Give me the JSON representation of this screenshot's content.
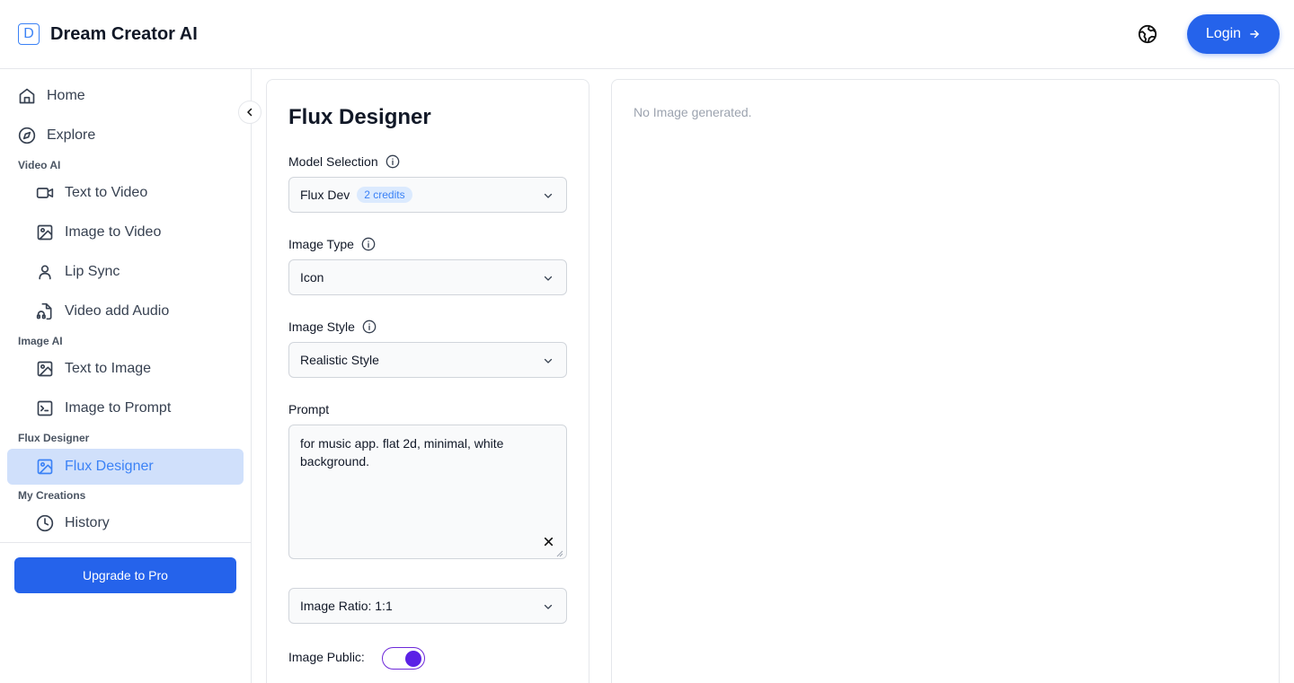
{
  "header": {
    "logo_letter": "D",
    "app_title": "Dream Creator AI",
    "login_label": "Login"
  },
  "sidebar": {
    "top_items": [
      {
        "label": "Home",
        "icon": "home-icon"
      },
      {
        "label": "Explore",
        "icon": "compass-icon"
      }
    ],
    "sections": [
      {
        "label": "Video AI",
        "items": [
          {
            "label": "Text to Video",
            "icon": "video-camera-icon"
          },
          {
            "label": "Image to Video",
            "icon": "image-icon"
          },
          {
            "label": "Lip Sync",
            "icon": "user-icon"
          },
          {
            "label": "Video add Audio",
            "icon": "file-audio-icon"
          }
        ]
      },
      {
        "label": "Image AI",
        "items": [
          {
            "label": "Text to Image",
            "icon": "image-icon"
          },
          {
            "label": "Image to Prompt",
            "icon": "terminal-icon"
          }
        ]
      },
      {
        "label": "Flux Designer",
        "items": [
          {
            "label": "Flux Designer",
            "icon": "image-icon",
            "active": true
          }
        ]
      },
      {
        "label": "My Creations",
        "items": [
          {
            "label": "History",
            "icon": "clock-icon"
          }
        ]
      }
    ],
    "upgrade_label": "Upgrade to Pro"
  },
  "form": {
    "title": "Flux Designer",
    "model_label": "Model Selection",
    "model_value": "Flux Dev",
    "model_badge": "2 credits",
    "type_label": "Image Type",
    "type_value": "Icon",
    "style_label": "Image Style",
    "style_value": "Realistic Style",
    "prompt_label": "Prompt",
    "prompt_value": "for music app. flat 2d, minimal, white background.",
    "ratio_value": "Image Ratio: 1:1",
    "public_label": "Image Public:",
    "public_on": true
  },
  "result": {
    "empty_text": "No Image generated."
  },
  "colors": {
    "accent": "#2563eb",
    "active_bg": "#d0e0fb",
    "toggle": "#5b21e6"
  }
}
